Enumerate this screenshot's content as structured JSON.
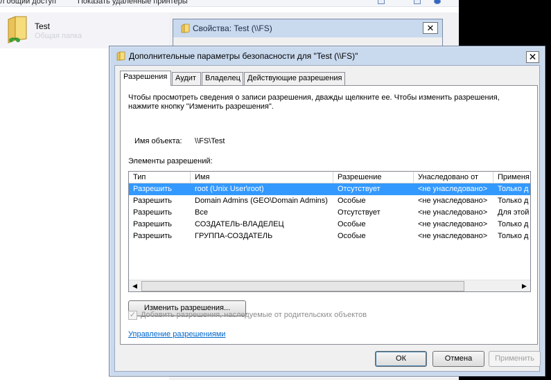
{
  "explorer": {
    "top_left_text": "л общий доступ",
    "top_right_text": "Показать удаленные принтеры",
    "item": {
      "name": "Test",
      "subtitle": "Общая папка"
    }
  },
  "properties_window": {
    "title": "Свойства: Test (\\\\FS)",
    "close": "✕"
  },
  "dialog": {
    "title": "Дополнительные параметры безопасности  для \"Test (\\\\FS)\"",
    "close": "✕",
    "tabs": [
      {
        "label": "Разрешения",
        "active": true
      },
      {
        "label": "Аудит",
        "active": false
      },
      {
        "label": "Владелец",
        "active": false
      },
      {
        "label": "Действующие разрешения",
        "active": false
      }
    ],
    "description": "Чтобы просмотреть сведения о записи разрешения, дважды щелкните ее. Чтобы изменить разрешения, нажмите кнопку \"Изменить разрешения\".",
    "object_label": "Имя объекта:",
    "object_value": "\\\\FS\\Test",
    "entries_label": "Элементы разрешений:",
    "columns": [
      "Тип",
      "Имя",
      "Разрешение",
      "Унаследовано от",
      "Применя"
    ],
    "rows": [
      {
        "type": "Разрешить",
        "name": "root (Unix User\\root)",
        "perm": "Отсутствует",
        "inherited": "<не унаследовано>",
        "apply": "Только д",
        "selected": true
      },
      {
        "type": "Разрешить",
        "name": "Domain Admins (GEO\\Domain Admins)",
        "perm": "Особые",
        "inherited": "<не унаследовано>",
        "apply": "Только д",
        "selected": false
      },
      {
        "type": "Разрешить",
        "name": "Все",
        "perm": "Отсутствует",
        "inherited": "<не унаследовано>",
        "apply": "Для этой",
        "selected": false
      },
      {
        "type": "Разрешить",
        "name": "СОЗДАТЕЛЬ-ВЛАДЕЛЕЦ",
        "perm": "Особые",
        "inherited": "<не унаследовано>",
        "apply": "Только д",
        "selected": false
      },
      {
        "type": "Разрешить",
        "name": "ГРУППА-СОЗДАТЕЛЬ",
        "perm": "Особые",
        "inherited": "<не унаследовано>",
        "apply": "Только д",
        "selected": false
      }
    ],
    "scroll_left": "◀",
    "scroll_right": "▶",
    "change_button": "Изменить разрешения...",
    "inherit_checkbox": {
      "label": "Добавить разрешения, наследуемые от родительских объектов",
      "checked": true,
      "disabled": true,
      "mark": "✓"
    },
    "manage_link": "Управление разрешениями",
    "ok": "ОК",
    "cancel": "Отмена",
    "apply": "Применить"
  }
}
